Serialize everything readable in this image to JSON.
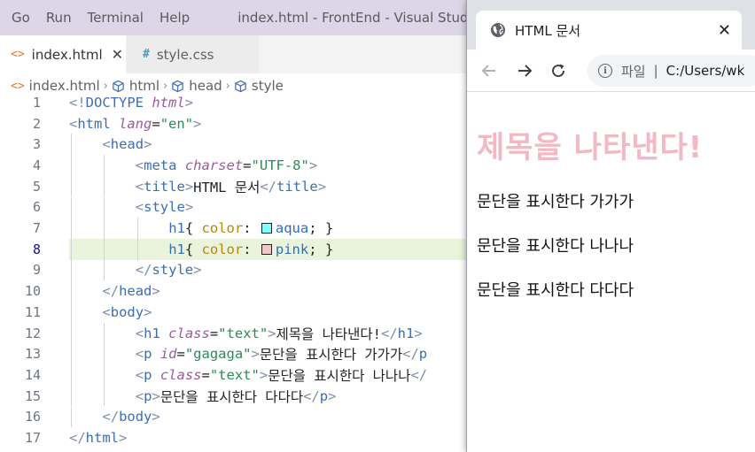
{
  "vscode": {
    "menu": [
      "Go",
      "Run",
      "Terminal",
      "Help"
    ],
    "window_title": "index.html - FrontEnd - Visual Studio Code",
    "tabs": [
      {
        "icon": "html-file-icon",
        "icon_glyph": "<>",
        "label": "index.html",
        "active": true,
        "close": "✕"
      },
      {
        "icon": "css-file-icon",
        "icon_glyph": "#",
        "label": "style.css",
        "active": false
      }
    ],
    "breadcrumb": [
      "index.html",
      "html",
      "head",
      "style"
    ],
    "current_line": 8,
    "lines": [
      {
        "n": "1",
        "indent": 0,
        "parts": [
          [
            "b",
            "<!"
          ],
          [
            "t",
            "DOCTYPE"
          ],
          [
            "x",
            " "
          ],
          [
            "a",
            "html"
          ],
          [
            "b",
            ">"
          ]
        ]
      },
      {
        "n": "2",
        "indent": 0,
        "parts": [
          [
            "b",
            "<"
          ],
          [
            "t",
            "html"
          ],
          [
            "x",
            " "
          ],
          [
            "a",
            "lang"
          ],
          [
            "x",
            "="
          ],
          [
            "s",
            "\"en\""
          ],
          [
            "b",
            ">"
          ]
        ]
      },
      {
        "n": "3",
        "indent": 1,
        "parts": [
          [
            "b",
            "<"
          ],
          [
            "t",
            "head"
          ],
          [
            "b",
            ">"
          ]
        ]
      },
      {
        "n": "4",
        "indent": 2,
        "parts": [
          [
            "b",
            "<"
          ],
          [
            "t",
            "meta"
          ],
          [
            "x",
            " "
          ],
          [
            "a",
            "charset"
          ],
          [
            "x",
            "="
          ],
          [
            "s",
            "\"UTF-8\""
          ],
          [
            "b",
            ">"
          ]
        ]
      },
      {
        "n": "5",
        "indent": 2,
        "parts": [
          [
            "b",
            "<"
          ],
          [
            "t",
            "title"
          ],
          [
            "b",
            ">"
          ],
          [
            "x",
            "HTML 문서"
          ],
          [
            "b",
            "</"
          ],
          [
            "t",
            "title"
          ],
          [
            "b",
            ">"
          ]
        ]
      },
      {
        "n": "6",
        "indent": 2,
        "parts": [
          [
            "b",
            "<"
          ],
          [
            "t",
            "style"
          ],
          [
            "b",
            ">"
          ]
        ]
      },
      {
        "n": "7",
        "indent": 3,
        "parts": [
          [
            "sel",
            "h1"
          ],
          [
            "x",
            "{ "
          ],
          [
            "p",
            "color"
          ],
          [
            "x",
            ": "
          ],
          [
            "sw",
            "#7fffff"
          ],
          [
            "v",
            "aqua"
          ],
          [
            "x",
            "; }"
          ]
        ]
      },
      {
        "n": "8",
        "indent": 3,
        "parts": [
          [
            "sel",
            "h1"
          ],
          [
            "x",
            "{ "
          ],
          [
            "p",
            "color"
          ],
          [
            "x",
            ": "
          ],
          [
            "sw",
            "#f4c3cc"
          ],
          [
            "v",
            "pink"
          ],
          [
            "x",
            "; }"
          ]
        ]
      },
      {
        "n": "9",
        "indent": 2,
        "parts": [
          [
            "b",
            "</"
          ],
          [
            "t",
            "style"
          ],
          [
            "b",
            ">"
          ]
        ]
      },
      {
        "n": "10",
        "indent": 1,
        "parts": [
          [
            "b",
            "</"
          ],
          [
            "t",
            "head"
          ],
          [
            "b",
            ">"
          ]
        ]
      },
      {
        "n": "11",
        "indent": 1,
        "parts": [
          [
            "b",
            "<"
          ],
          [
            "t",
            "body"
          ],
          [
            "b",
            ">"
          ]
        ]
      },
      {
        "n": "12",
        "indent": 2,
        "parts": [
          [
            "b",
            "<"
          ],
          [
            "t",
            "h1"
          ],
          [
            "x",
            " "
          ],
          [
            "a",
            "class"
          ],
          [
            "x",
            "="
          ],
          [
            "s",
            "\"text\""
          ],
          [
            "b",
            ">"
          ],
          [
            "x",
            "제목을 나타낸다!"
          ],
          [
            "b",
            "</"
          ],
          [
            "t",
            "h1"
          ],
          [
            "b",
            ">"
          ]
        ]
      },
      {
        "n": "13",
        "indent": 2,
        "parts": [
          [
            "b",
            "<"
          ],
          [
            "t",
            "p"
          ],
          [
            "x",
            " "
          ],
          [
            "a",
            "id"
          ],
          [
            "x",
            "="
          ],
          [
            "s",
            "\"gagaga\""
          ],
          [
            "b",
            ">"
          ],
          [
            "x",
            "문단을 표시한다 가가가"
          ],
          [
            "b",
            "</"
          ],
          [
            "t",
            "p"
          ]
        ]
      },
      {
        "n": "14",
        "indent": 2,
        "parts": [
          [
            "b",
            "<"
          ],
          [
            "t",
            "p"
          ],
          [
            "x",
            " "
          ],
          [
            "a",
            "class"
          ],
          [
            "x",
            "="
          ],
          [
            "s",
            "\"text\""
          ],
          [
            "b",
            ">"
          ],
          [
            "x",
            "문단을 표시한다 나나나"
          ],
          [
            "b",
            "</"
          ]
        ]
      },
      {
        "n": "15",
        "indent": 2,
        "parts": [
          [
            "b",
            "<"
          ],
          [
            "t",
            "p"
          ],
          [
            "b",
            ">"
          ],
          [
            "x",
            "문단을 표시한다 다다다"
          ],
          [
            "b",
            "</"
          ],
          [
            "t",
            "p"
          ],
          [
            "b",
            ">"
          ]
        ]
      },
      {
        "n": "16",
        "indent": 1,
        "parts": [
          [
            "b",
            "</"
          ],
          [
            "t",
            "body"
          ],
          [
            "b",
            ">"
          ]
        ]
      },
      {
        "n": "17",
        "indent": 0,
        "parts": [
          [
            "b",
            "</"
          ],
          [
            "t",
            "html"
          ],
          [
            "b",
            ">"
          ]
        ]
      }
    ]
  },
  "browser": {
    "tab_title": "HTML 문서",
    "tab_icon": "globe-icon",
    "tab_close": "✕",
    "address_scheme": "파일",
    "address_separator": "|",
    "address_path": "C:/Users/wk",
    "page": {
      "heading": "제목을 나타낸다!",
      "heading_color": "#f4b8c4",
      "paragraphs": [
        "문단을 표시한다 가가가",
        "문단을 표시한다 나나나",
        "문단을 표시한다 다다다"
      ]
    }
  },
  "colors": {
    "titlebar": "#ddd6e8",
    "current_line_highlight": "#eaf4dd",
    "swatch_aqua": "#7fffff",
    "swatch_pink": "#f4c3cc"
  }
}
